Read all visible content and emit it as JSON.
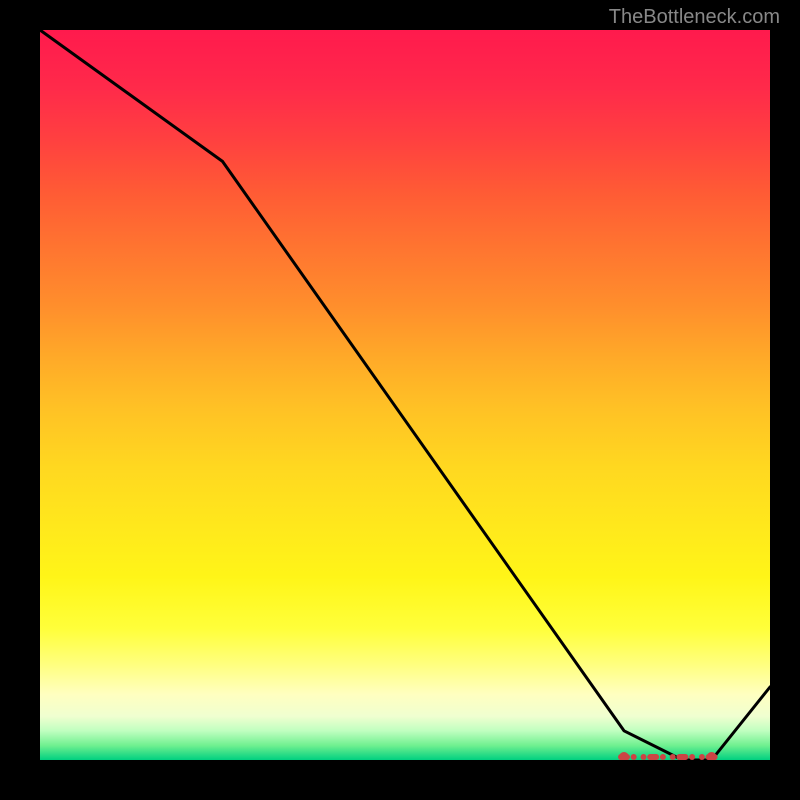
{
  "watermark": "TheBottleneck.com",
  "chart_data": {
    "type": "line",
    "title": "",
    "xlabel": "",
    "ylabel": "",
    "xlim": [
      0,
      100
    ],
    "ylim": [
      0,
      100
    ],
    "x": [
      0,
      25,
      80,
      88,
      92,
      100
    ],
    "values": [
      100,
      82,
      4,
      0,
      0,
      10
    ],
    "marker_region_x": [
      80,
      92
    ],
    "marker_color": "#cc4444",
    "line_color": "#000000",
    "background_gradient": [
      "#ff1a4d",
      "#ffff3a",
      "#00d080"
    ]
  }
}
